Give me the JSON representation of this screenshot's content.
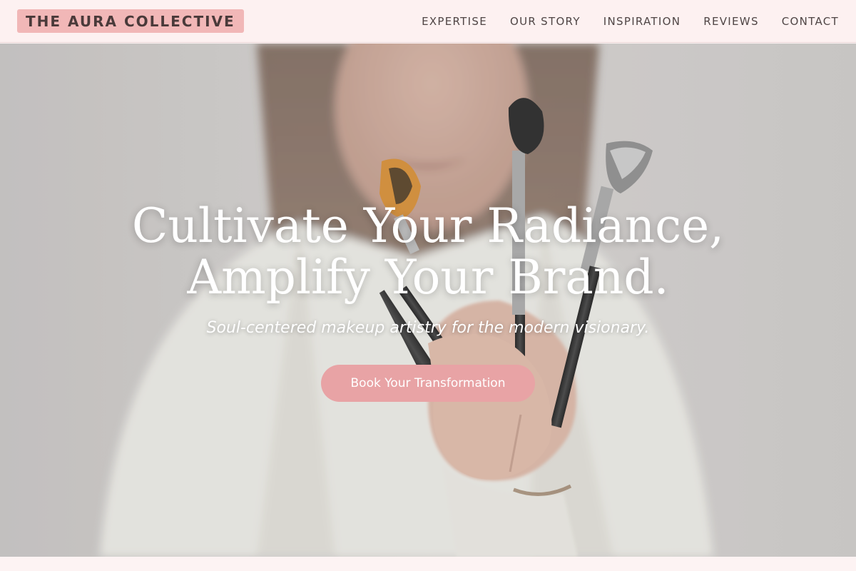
{
  "brand": {
    "logo_text": "THE AURA COLLECTIVE",
    "accent_color": "#f1b7b7",
    "cta_color": "#e8a3a5"
  },
  "nav": {
    "items": [
      {
        "label": "EXPERTISE"
      },
      {
        "label": "OUR STORY"
      },
      {
        "label": "INSPIRATION"
      },
      {
        "label": "REVIEWS"
      },
      {
        "label": "CONTACT"
      }
    ]
  },
  "hero": {
    "headline_line1": "Cultivate Your Radiance,",
    "headline_line2": "Amplify Your Brand.",
    "subheadline": "Soul-centered makeup artistry for the modern visionary.",
    "cta_label": "Book Your Transformation",
    "image_subject": "woman holding makeup brushes"
  }
}
